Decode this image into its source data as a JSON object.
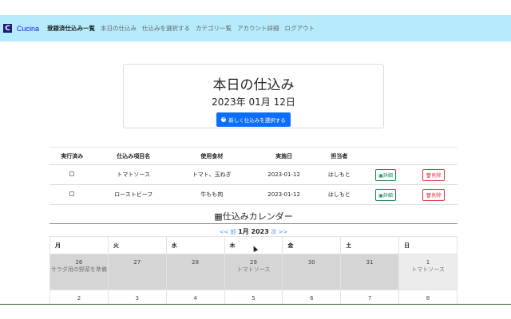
{
  "nav": {
    "logo_letter": "C",
    "brand": "Cucina",
    "items": [
      "登録済仕込み一覧",
      "本日の仕込み",
      "仕込みを選択する",
      "カテゴリ一覧",
      "アカウント詳細",
      "ログアウト"
    ]
  },
  "hero": {
    "title": "本日の仕込み",
    "date": "2023年 01月 12日",
    "button": "新しく仕込みを選択する"
  },
  "table": {
    "headers": [
      "実行済み",
      "仕込み項目名",
      "使用食材",
      "実施日",
      "担当者"
    ],
    "rows": [
      {
        "name": "トマトソース",
        "ingredients": "トマト、玉ねぎ",
        "date": "2023-01-12",
        "person": "はしもと",
        "detail": "詳細",
        "delete": "削除"
      },
      {
        "name": "ローストビーフ",
        "ingredients": "牛もも肉",
        "date": "2023-01-12",
        "person": "はしもと",
        "detail": "詳細",
        "delete": "削除"
      }
    ]
  },
  "calendar": {
    "title": "仕込みカレンダー",
    "prev": "<< 前",
    "month": "1月 2023",
    "next": "次 >>",
    "weekdays": [
      "月",
      "火",
      "水",
      "木",
      "金",
      "土",
      "日"
    ],
    "week1": [
      {
        "d": "26",
        "ev": "サラダ用の野菜を準備"
      },
      {
        "d": "27",
        "ev": ""
      },
      {
        "d": "28",
        "ev": ""
      },
      {
        "d": "29",
        "ev": "トマトソース"
      },
      {
        "d": "30",
        "ev": ""
      },
      {
        "d": "31",
        "ev": ""
      },
      {
        "d": "1",
        "ev": "トマトソース"
      }
    ],
    "week2": [
      "2",
      "3",
      "4",
      "5",
      "6",
      "7",
      "8"
    ]
  }
}
